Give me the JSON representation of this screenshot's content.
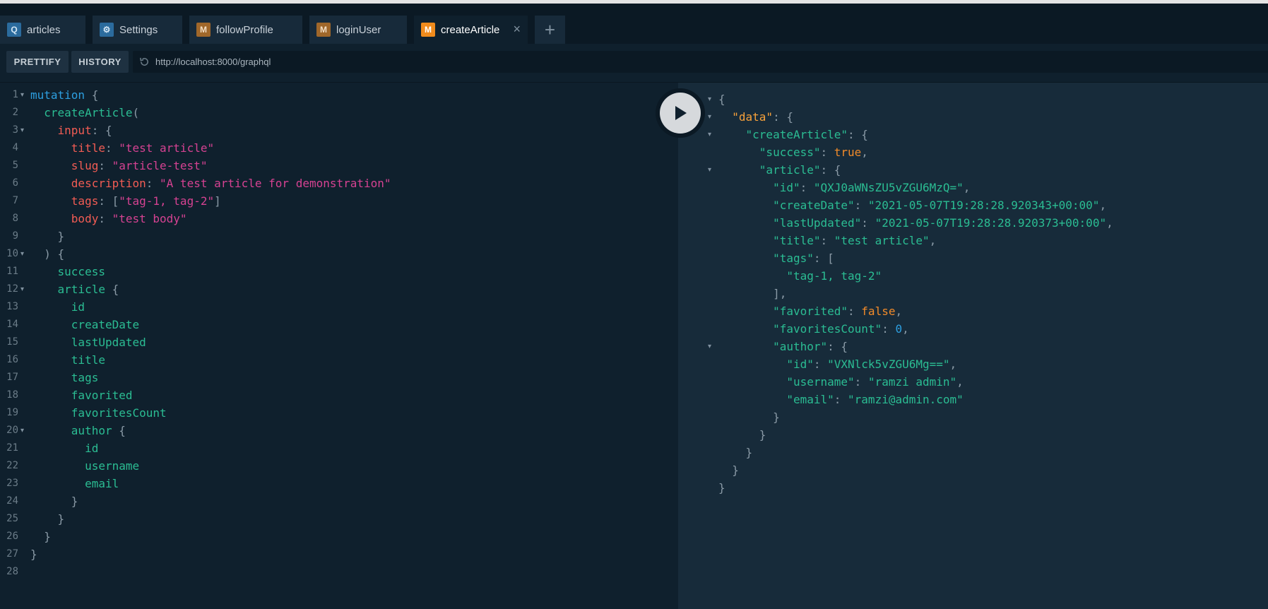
{
  "tabs": [
    {
      "badge": "Q",
      "label": "articles",
      "type": "query"
    },
    {
      "badge": "⚙",
      "label": "Settings",
      "type": "settings"
    },
    {
      "badge": "M",
      "label": "followProfile",
      "type": "mutation"
    },
    {
      "badge": "M",
      "label": "loginUser",
      "type": "mutation"
    },
    {
      "badge": "M",
      "label": "createArticle",
      "type": "mutation",
      "active": true,
      "close": "×"
    }
  ],
  "add_tab": "+",
  "toolbar": {
    "prettify_label": "PRETTIFY",
    "history_label": "HISTORY",
    "url": "http://localhost:8000/graphql"
  },
  "query_lines": [
    {
      "n": "1",
      "fold": true,
      "tokens": [
        [
          "kw",
          "mutation"
        ],
        [
          "punc",
          " {"
        ]
      ]
    },
    {
      "n": "2",
      "tokens": [
        [
          "",
          "  "
        ],
        [
          "fn",
          "createArticle"
        ],
        [
          "punc",
          "("
        ]
      ]
    },
    {
      "n": "3",
      "fold": true,
      "tokens": [
        [
          "",
          "    "
        ],
        [
          "arg",
          "input"
        ],
        [
          "punc",
          ": {"
        ]
      ]
    },
    {
      "n": "4",
      "tokens": [
        [
          "",
          "      "
        ],
        [
          "arg",
          "title"
        ],
        [
          "punc",
          ": "
        ],
        [
          "str",
          "\"test article\""
        ]
      ]
    },
    {
      "n": "5",
      "tokens": [
        [
          "",
          "      "
        ],
        [
          "arg",
          "slug"
        ],
        [
          "punc",
          ": "
        ],
        [
          "str",
          "\"article-test\""
        ]
      ]
    },
    {
      "n": "6",
      "tokens": [
        [
          "",
          "      "
        ],
        [
          "arg",
          "description"
        ],
        [
          "punc",
          ": "
        ],
        [
          "str",
          "\"A test article for demonstration\""
        ]
      ]
    },
    {
      "n": "7",
      "tokens": [
        [
          "",
          "      "
        ],
        [
          "arg",
          "tags"
        ],
        [
          "punc",
          ": ["
        ],
        [
          "str",
          "\"tag-1, tag-2\""
        ],
        [
          "punc",
          "]"
        ]
      ]
    },
    {
      "n": "8",
      "tokens": [
        [
          "",
          "      "
        ],
        [
          "arg",
          "body"
        ],
        [
          "punc",
          ": "
        ],
        [
          "str",
          "\"test body\""
        ]
      ]
    },
    {
      "n": "9",
      "tokens": [
        [
          "",
          "    "
        ],
        [
          "punc",
          "}"
        ]
      ]
    },
    {
      "n": "10",
      "fold": true,
      "tokens": [
        [
          "",
          "  "
        ],
        [
          "punc",
          ") {"
        ]
      ]
    },
    {
      "n": "11",
      "tokens": [
        [
          "",
          "    "
        ],
        [
          "fld",
          "success"
        ]
      ]
    },
    {
      "n": "12",
      "fold": true,
      "tokens": [
        [
          "",
          "    "
        ],
        [
          "fld",
          "article"
        ],
        [
          "punc",
          " {"
        ]
      ]
    },
    {
      "n": "13",
      "tokens": [
        [
          "",
          "      "
        ],
        [
          "fld",
          "id"
        ]
      ]
    },
    {
      "n": "14",
      "tokens": [
        [
          "",
          "      "
        ],
        [
          "fld",
          "createDate"
        ]
      ]
    },
    {
      "n": "15",
      "tokens": [
        [
          "",
          "      "
        ],
        [
          "fld",
          "lastUpdated"
        ]
      ]
    },
    {
      "n": "16",
      "tokens": [
        [
          "",
          "      "
        ],
        [
          "fld",
          "title"
        ]
      ]
    },
    {
      "n": "17",
      "tokens": [
        [
          "",
          "      "
        ],
        [
          "fld",
          "tags"
        ]
      ]
    },
    {
      "n": "18",
      "tokens": [
        [
          "",
          "      "
        ],
        [
          "fld",
          "favorited"
        ]
      ]
    },
    {
      "n": "19",
      "tokens": [
        [
          "",
          "      "
        ],
        [
          "fld",
          "favoritesCount"
        ]
      ]
    },
    {
      "n": "20",
      "fold": true,
      "tokens": [
        [
          "",
          "      "
        ],
        [
          "fld",
          "author"
        ],
        [
          "punc",
          " {"
        ]
      ]
    },
    {
      "n": "21",
      "tokens": [
        [
          "",
          "        "
        ],
        [
          "fld",
          "id"
        ]
      ]
    },
    {
      "n": "22",
      "tokens": [
        [
          "",
          "        "
        ],
        [
          "fld",
          "username"
        ]
      ]
    },
    {
      "n": "23",
      "tokens": [
        [
          "",
          "        "
        ],
        [
          "fld",
          "email"
        ]
      ]
    },
    {
      "n": "24",
      "tokens": [
        [
          "",
          "      "
        ],
        [
          "punc",
          "}"
        ]
      ]
    },
    {
      "n": "25",
      "tokens": [
        [
          "",
          "    "
        ],
        [
          "punc",
          "}"
        ]
      ]
    },
    {
      "n": "26",
      "tokens": [
        [
          "",
          "  "
        ],
        [
          "punc",
          "}"
        ]
      ]
    },
    {
      "n": "27",
      "tokens": [
        [
          "punc",
          "}"
        ]
      ]
    },
    {
      "n": "28",
      "tokens": []
    }
  ],
  "result_lines": [
    {
      "fold": true,
      "tokens": [
        [
          "punc",
          "{"
        ]
      ]
    },
    {
      "fold": true,
      "tokens": [
        [
          "",
          "  "
        ],
        [
          "rkey-data",
          "\"data\""
        ],
        [
          "punc",
          ": {"
        ]
      ]
    },
    {
      "fold": true,
      "tokens": [
        [
          "",
          "    "
        ],
        [
          "rkey",
          "\"createArticle\""
        ],
        [
          "punc",
          ": {"
        ]
      ]
    },
    {
      "tokens": [
        [
          "",
          "      "
        ],
        [
          "rkey",
          "\"success\""
        ],
        [
          "punc",
          ": "
        ],
        [
          "rbool",
          "true"
        ],
        [
          "punc",
          ","
        ]
      ]
    },
    {
      "fold": true,
      "tokens": [
        [
          "",
          "      "
        ],
        [
          "rkey",
          "\"article\""
        ],
        [
          "punc",
          ": {"
        ]
      ]
    },
    {
      "tokens": [
        [
          "",
          "        "
        ],
        [
          "rkey",
          "\"id\""
        ],
        [
          "punc",
          ": "
        ],
        [
          "rstr",
          "\"QXJ0aWNsZU5vZGU6MzQ=\""
        ],
        [
          "punc",
          ","
        ]
      ]
    },
    {
      "tokens": [
        [
          "",
          "        "
        ],
        [
          "rkey",
          "\"createDate\""
        ],
        [
          "punc",
          ": "
        ],
        [
          "rstr",
          "\"2021-05-07T19:28:28.920343+00:00\""
        ],
        [
          "punc",
          ","
        ]
      ]
    },
    {
      "tokens": [
        [
          "",
          "        "
        ],
        [
          "rkey",
          "\"lastUpdated\""
        ],
        [
          "punc",
          ": "
        ],
        [
          "rstr",
          "\"2021-05-07T19:28:28.920373+00:00\""
        ],
        [
          "punc",
          ","
        ]
      ]
    },
    {
      "tokens": [
        [
          "",
          "        "
        ],
        [
          "rkey",
          "\"title\""
        ],
        [
          "punc",
          ": "
        ],
        [
          "rstr",
          "\"test article\""
        ],
        [
          "punc",
          ","
        ]
      ]
    },
    {
      "tokens": [
        [
          "",
          "        "
        ],
        [
          "rkey",
          "\"tags\""
        ],
        [
          "punc",
          ": ["
        ]
      ]
    },
    {
      "tokens": [
        [
          "",
          "          "
        ],
        [
          "rstr",
          "\"tag-1, tag-2\""
        ]
      ]
    },
    {
      "tokens": [
        [
          "",
          "        "
        ],
        [
          "punc",
          "],"
        ]
      ]
    },
    {
      "tokens": [
        [
          "",
          "        "
        ],
        [
          "rkey",
          "\"favorited\""
        ],
        [
          "punc",
          ": "
        ],
        [
          "rbool",
          "false"
        ],
        [
          "punc",
          ","
        ]
      ]
    },
    {
      "tokens": [
        [
          "",
          "        "
        ],
        [
          "rkey",
          "\"favoritesCount\""
        ],
        [
          "punc",
          ": "
        ],
        [
          "rnum",
          "0"
        ],
        [
          "punc",
          ","
        ]
      ]
    },
    {
      "fold": true,
      "tokens": [
        [
          "",
          "        "
        ],
        [
          "rkey",
          "\"author\""
        ],
        [
          "punc",
          ": {"
        ]
      ]
    },
    {
      "tokens": [
        [
          "",
          "          "
        ],
        [
          "rkey",
          "\"id\""
        ],
        [
          "punc",
          ": "
        ],
        [
          "rstr",
          "\"VXNlck5vZGU6Mg==\""
        ],
        [
          "punc",
          ","
        ]
      ]
    },
    {
      "tokens": [
        [
          "",
          "          "
        ],
        [
          "rkey",
          "\"username\""
        ],
        [
          "punc",
          ": "
        ],
        [
          "rstr",
          "\"ramzi admin\""
        ],
        [
          "punc",
          ","
        ]
      ]
    },
    {
      "tokens": [
        [
          "",
          "          "
        ],
        [
          "rkey",
          "\"email\""
        ],
        [
          "punc",
          ": "
        ],
        [
          "rstr",
          "\"ramzi@admin.com\""
        ]
      ]
    },
    {
      "tokens": [
        [
          "",
          "        "
        ],
        [
          "punc",
          "}"
        ]
      ]
    },
    {
      "tokens": [
        [
          "",
          "      "
        ],
        [
          "punc",
          "}"
        ]
      ]
    },
    {
      "tokens": [
        [
          "",
          "    "
        ],
        [
          "punc",
          "}"
        ]
      ]
    },
    {
      "tokens": [
        [
          "",
          "  "
        ],
        [
          "punc",
          "}"
        ]
      ]
    },
    {
      "tokens": [
        [
          "punc",
          "}"
        ]
      ]
    }
  ],
  "colors": {
    "background": "#0f202d",
    "result_background": "#172b3a",
    "keyword": "#2d9fe0",
    "field": "#2bbd93",
    "argument": "#f25c54",
    "string": "#d64292",
    "boolean": "#f28b2a",
    "mutation_badge": "#f08b1c"
  },
  "icons": {
    "run": "play-icon",
    "reload": "history-reload-icon",
    "settings": "gear-icon"
  }
}
